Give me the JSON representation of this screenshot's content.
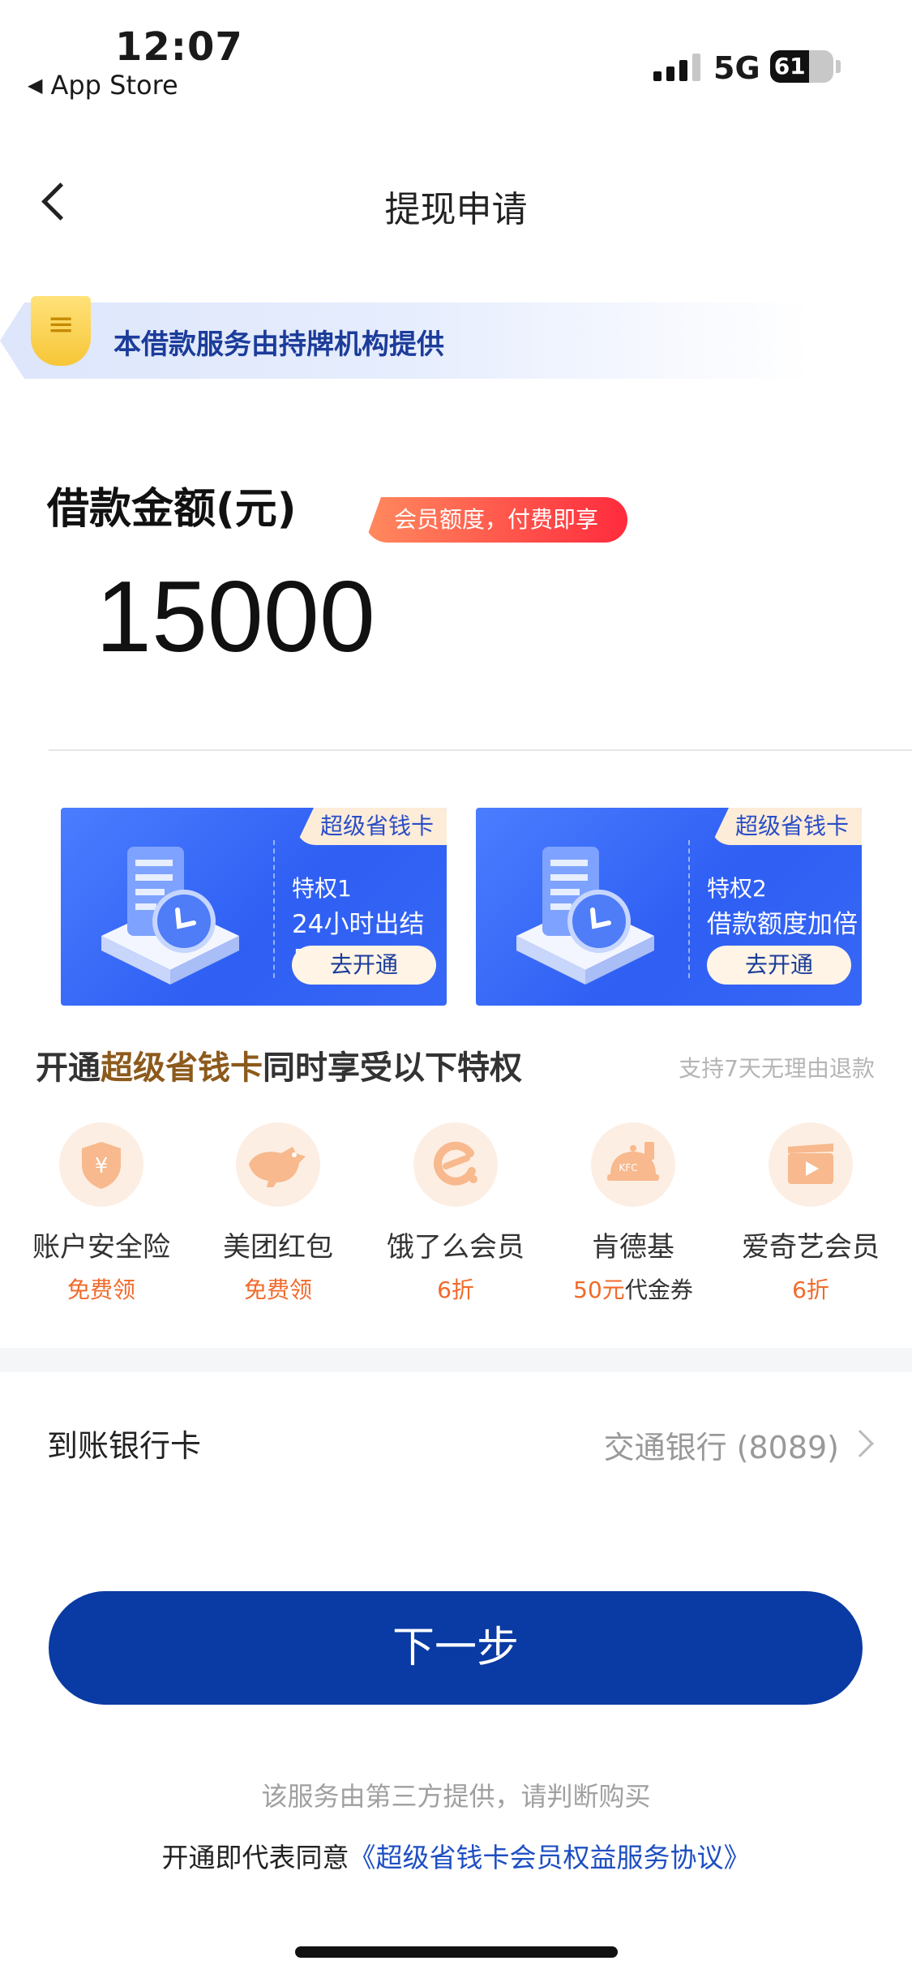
{
  "status_bar": {
    "time": "12:07",
    "back_app": "App Store",
    "network": "5G",
    "battery": "61",
    "battery_level": 0.61
  },
  "nav": {
    "title": "提现申请"
  },
  "license_banner": {
    "text": "本借款服务由持牌机构提供"
  },
  "amount": {
    "label": "借款金额(元)",
    "member_tag": "会员额度，付费即享",
    "value": "15000"
  },
  "cards": [
    {
      "tag": "超级省钱卡",
      "line1": "特权1",
      "line2": "24小时出结果",
      "button": "去开通"
    },
    {
      "tag": "超级省钱卡",
      "line1": "特权2",
      "line2": "借款额度加倍",
      "button": "去开通"
    }
  ],
  "privileges": {
    "title_prefix": "开通",
    "title_highlight": "超级省钱卡",
    "title_suffix": "同时享受以下特权",
    "note": "支持7天无理由退款",
    "items": [
      {
        "icon": "shield-yen-icon",
        "name": "账户安全险",
        "sub": "免费领",
        "sub_rest": ""
      },
      {
        "icon": "kangaroo-icon",
        "name": "美团红包",
        "sub": "免费领",
        "sub_rest": ""
      },
      {
        "icon": "eleme-icon",
        "name": "饿了么会员",
        "sub": "6折",
        "sub_rest": ""
      },
      {
        "icon": "kfc-icon",
        "name": "肯德基",
        "sub": "50元",
        "sub_rest": "代金券"
      },
      {
        "icon": "video-icon",
        "name": "爱奇艺会员",
        "sub": "6折",
        "sub_rest": ""
      }
    ]
  },
  "bank": {
    "label": "到账银行卡",
    "value": "交通银行 (8089)"
  },
  "next_button": "下一步",
  "footer": {
    "notice": "该服务由第三方提供，请判断购买",
    "agree_prefix": "开通即代表同意",
    "agreement": "《超级省钱卡会员权益服务协议》"
  },
  "colors": {
    "primary_button": "#0a3aa4",
    "card_blue": "#2f5ff3",
    "accent_orange": "#f06a2a",
    "highlight_brown": "#8c5a1c",
    "link_blue": "#1e4fc2"
  }
}
